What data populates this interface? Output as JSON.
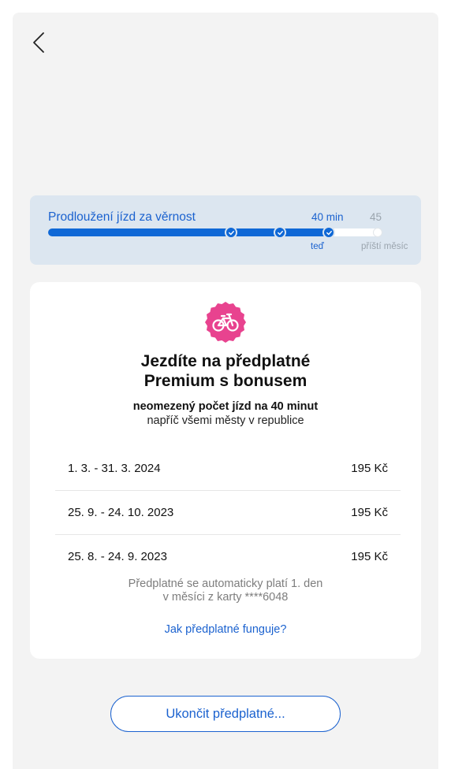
{
  "nav": {
    "back_icon": "chevron-left-icon"
  },
  "loyalty": {
    "title": "Prodloužení jízd za věrnost",
    "current_tick": "40 min",
    "next_tick": "45",
    "current_caption": "teď",
    "next_caption": "příští měsíc",
    "progress_fraction": 0.85,
    "completed_checkpoints": 3
  },
  "card": {
    "badge_icon": "bicycle-icon",
    "badge_color": "#e8438f",
    "title_line1": "Jezdíte na předplatné",
    "title_line2": "Premium s bonusem",
    "subtitle_strong": "neomezený počet jízd na 40 minut",
    "subtitle": "napříč všemi městy v republice",
    "payments": [
      {
        "period": "1. 3. - 31. 3. 2024",
        "amount": "195 Kč"
      },
      {
        "period": "25. 9. - 24. 10. 2023",
        "amount": "195 Kč"
      },
      {
        "period": "25. 8. - 24. 9. 2023",
        "amount": "195 Kč"
      }
    ],
    "note_line1": "Předplatné se automaticky platí 1. den",
    "note_line2": "v měsíci z karty ****6048",
    "how_link": "Jak předplatné funguje?"
  },
  "actions": {
    "cancel_label": "Ukončit předplatné..."
  },
  "colors": {
    "accent": "#1b62cf",
    "bar": "#0f68d6",
    "panel": "#dce6f0"
  }
}
